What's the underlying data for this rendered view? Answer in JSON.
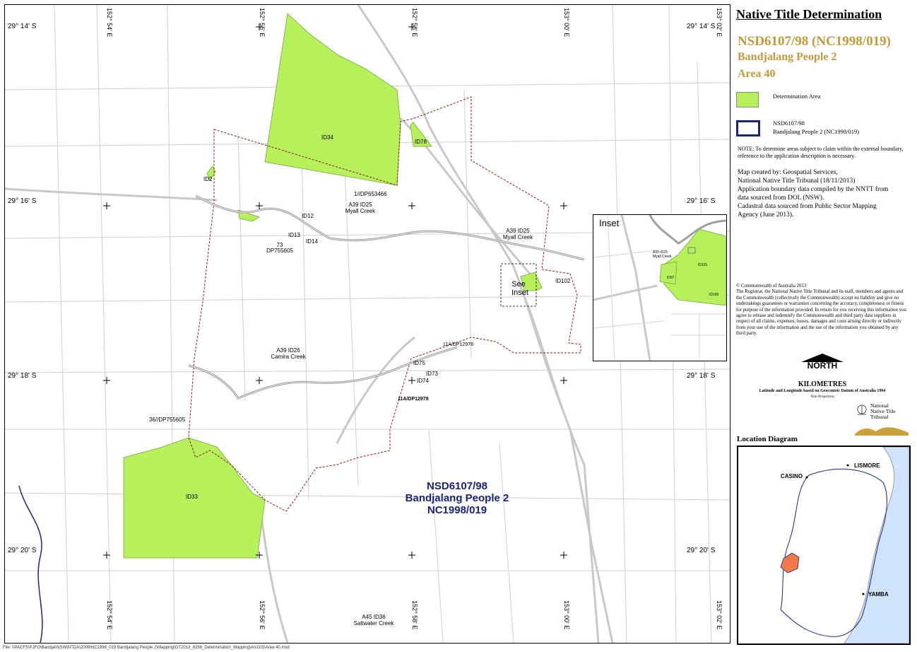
{
  "map": {
    "lat_labels": {
      "left_top": "29° 14' S",
      "right_top": "29° 14' S",
      "left_16": "29° 16' S",
      "right_16": "29° 16' S",
      "left_18": "29° 18' S",
      "right_18": "29° 18' S",
      "left_20": "29° 20' S",
      "right_20": "29° 20' S"
    },
    "lon_labels": {
      "t1": "152° 54' E",
      "t2": "152° 56' E",
      "t3": "152° 58' E",
      "t4": "153° 00' E",
      "t5": "153° 02' E",
      "b1": "152° 54' E",
      "b2": "152° 56' E",
      "b3": "152° 58' E",
      "b4": "153° 00' E",
      "b5": "153° 02' E"
    },
    "labels": {
      "id34": "ID34",
      "id78": "ID78",
      "id2": "ID2",
      "dp653466": "1//DP653466",
      "a39_id25_a": "A39 ID25",
      "myall_a": "Myall Creek",
      "id12": "ID12",
      "id13": "ID13",
      "id14": "ID14",
      "l73": "73",
      "dp755605_a": "DP755605",
      "a39_id25_b": "A39 ID25",
      "myall_b": "Myall Creek",
      "see": "See",
      "inset_word": "Inset",
      "id102": "ID102",
      "dp12978_a": "11A/DP12978",
      "id75": "ID75",
      "id73": "ID73",
      "id74": "ID74",
      "a39_id26": "A39 ID26",
      "camira": "Camira Creek",
      "dp12978_b": "11A/DP12978",
      "dp755605_b": "36//DP755605",
      "id33": "ID33",
      "a45_id36": "A45 ID36",
      "saltwater": "Saltwater Creek"
    },
    "claim_title": [
      "NSD6107/98",
      "Bandjalang People 2",
      "NC1998/019"
    ]
  },
  "inset": {
    "title": "Inset",
    "labels": {
      "a39": "A39 ID25",
      "myall": "Myall Creek",
      "id101": "ID101",
      "id97": "ID97",
      "id100": "ID100"
    }
  },
  "panel": {
    "title": "Native Title Determination",
    "case": "NSD6107/98 (NC1998/019)",
    "group": "Bandjalang People 2",
    "area": "Area 40",
    "legend": {
      "determination": "Determination Area",
      "boundary_line1": "NSD6107/98",
      "boundary_line2": "Bandjalang People 2 (NC1998/019)"
    },
    "note": "NOTE: To determine areas subject to claim within the external boundary, reference to the application description is necessary.",
    "credit": [
      "Map created by: Geospatial Services,",
      "National Native Title Tribunal   (18/11/2013)",
      "Application boundary data compiled by the NNTT from",
      "data sourced from DOL (NSW).",
      "Cadastral data sourced from Public Sector Mapping",
      "Agency (June 2013)."
    ],
    "copyright_title": "© Commonwealth of Australia 2013",
    "copyright_body": "The Registrar, the National Native Title Tribunal and its staff, members and agents and the Commonwealth (collectively the Commonwealth) accept no liability and give no undertakings guarantees or warranties concerning the accuracy, completeness or fitness for purpose of the information provided. In return for you receiving this information you agree to release and indemnify the Commonwealth and third party data suppliers in respect of all claims, expenses, losses, damages and costs arising directly or indirectly from your use of the information and the use of the information you obtained by any third party.",
    "north": "NORTH",
    "km": "KILOMETRES",
    "datum": "Latitude and Longitude based on Geocentric Datum of Australia 1994",
    "projection": "Non Projection",
    "tribunal": [
      "National",
      "Native Title",
      "Tribunal"
    ],
    "location_title": "Location Diagram",
    "places": {
      "casino": "CASINO",
      "lismore": "LISMORE",
      "yamba": "YAMBA"
    }
  },
  "colors": {
    "determination": "#b6f05a",
    "boundary": "#1a237e",
    "claim_boundary": "#8b1a1a",
    "location_claim": "#f07a4a",
    "sea": "#cfe3ff"
  },
  "footer": "File: \\\\PACFS\\PJFO\\Bandjal\\NSW\\NTDA\\2009\\NC1998_019 Bandjalang People 2\\Mapping\\GT2013_0256_Determination_Mapping\\ArcGIS\\Area 40.mxd"
}
